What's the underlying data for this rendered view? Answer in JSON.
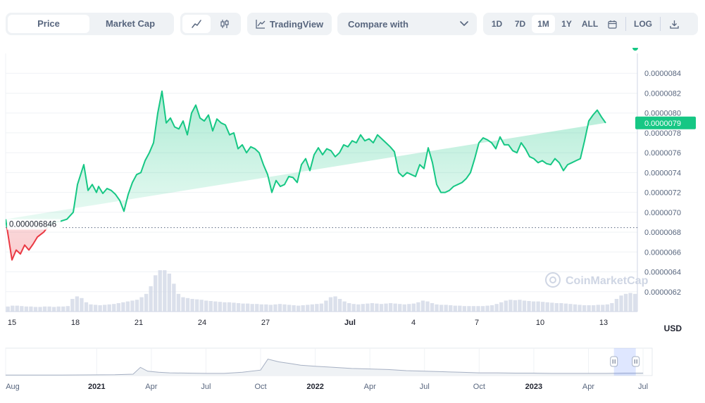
{
  "toolbar": {
    "type_tabs": [
      "Price",
      "Market Cap"
    ],
    "tradingview_label": "TradingView",
    "compare_label": "Compare with",
    "ranges": [
      "1D",
      "7D",
      "1M",
      "1Y",
      "ALL"
    ],
    "active_range": "1M",
    "log_label": "LOG"
  },
  "colors": {
    "up": "#16c784",
    "down": "#ea3943",
    "grid": "#eff2f5",
    "volume": "#cfd6e4"
  },
  "chart_data": {
    "type": "area",
    "currency": "USD",
    "watermark": "CoinMarketCap",
    "baseline_label": "0.000006846",
    "current_label": "0.0000079",
    "baseline": 6.846e-06,
    "ylim": [
      6e-06,
      8.6e-06
    ],
    "yticks": [
      "0.0000084",
      "0.0000082",
      "0.0000080",
      "0.0000078",
      "0.0000076",
      "0.0000074",
      "0.0000072",
      "0.0000070",
      "0.0000068",
      "0.0000066",
      "0.0000064",
      "0.0000062"
    ],
    "ytick_values": [
      8.4e-06,
      8.2e-06,
      8e-06,
      7.8e-06,
      7.6e-06,
      7.4e-06,
      7.2e-06,
      7e-06,
      6.8e-06,
      6.6e-06,
      6.4e-06,
      6.2e-06
    ],
    "xticks": [
      "15",
      "18",
      "21",
      "24",
      "27",
      "Jul",
      "4",
      "7",
      "10",
      "13"
    ],
    "xtick_days": [
      0,
      3,
      6,
      9,
      12,
      16,
      19,
      22,
      25,
      28
    ],
    "xlim_days": [
      -0.3,
      29.6
    ],
    "price_days": [
      -0.3,
      0,
      0.2,
      0.4,
      0.6,
      0.8,
      1,
      1.2,
      1.5,
      1.8,
      2,
      2.3,
      2.6,
      2.9,
      3.1,
      3.4,
      3.6,
      3.8,
      4,
      4.1,
      4.3,
      4.5,
      4.7,
      4.9,
      5.1,
      5.3,
      5.5,
      5.7,
      5.9,
      6.1,
      6.3,
      6.5,
      6.7,
      6.9,
      7.1,
      7.3,
      7.5,
      7.7,
      7.9,
      8.1,
      8.3,
      8.5,
      8.7,
      8.9,
      9.1,
      9.3,
      9.5,
      9.7,
      9.9,
      10.1,
      10.3,
      10.5,
      10.7,
      10.9,
      11.1,
      11.3,
      11.5,
      11.7,
      11.9,
      12.1,
      12.3,
      12.5,
      12.7,
      12.9,
      13.1,
      13.3,
      13.5,
      13.7,
      13.9,
      14.1,
      14.3,
      14.5,
      14.7,
      14.9,
      15.1,
      15.3,
      15.5,
      15.7,
      15.9,
      16.1,
      16.3,
      16.5,
      16.7,
      16.9,
      17.1,
      17.3,
      17.5,
      17.7,
      17.9,
      18.1,
      18.3,
      18.5,
      18.7,
      18.9,
      19.1,
      19.3,
      19.5,
      19.7,
      19.9,
      20.1,
      20.3,
      20.5,
      20.7,
      20.9,
      21.1,
      21.3,
      21.5,
      21.7,
      21.9,
      22.1,
      22.3,
      22.5,
      22.7,
      22.9,
      23.1,
      23.3,
      23.5,
      23.7,
      23.9,
      24.1,
      24.3,
      24.5,
      24.7,
      24.9,
      25.1,
      25.3,
      25.5,
      25.7,
      25.9,
      26.1,
      26.3,
      26.5,
      26.7,
      26.9,
      27.1,
      27.3,
      27.5,
      27.7,
      27.9,
      28.1,
      28.3,
      28.5,
      28.7,
      28.9,
      29.1,
      29.3,
      29.5
    ],
    "price_values": [
      6.93e-06,
      6.52e-06,
      6.62e-06,
      6.58e-06,
      6.67e-06,
      6.62e-06,
      6.68e-06,
      6.75e-06,
      6.8e-06,
      6.88e-06,
      6.9e-06,
      6.91e-06,
      6.93e-06,
      7e-06,
      7.28e-06,
      7.48e-06,
      7.22e-06,
      7.28e-06,
      7.2e-06,
      7.26e-06,
      7.19e-06,
      7.24e-06,
      7.22e-06,
      7.18e-06,
      7.12e-06,
      7.01e-06,
      7.18e-06,
      7.3e-06,
      7.38e-06,
      7.4e-06,
      7.52e-06,
      7.6e-06,
      7.7e-06,
      8e-06,
      8.22e-06,
      7.9e-06,
      7.95e-06,
      7.86e-06,
      7.84e-06,
      7.92e-06,
      7.78e-06,
      8e-06,
      8.08e-06,
      7.95e-06,
      7.92e-06,
      7.98e-06,
      7.82e-06,
      7.94e-06,
      7.9e-06,
      7.88e-06,
      7.78e-06,
      7.8e-06,
      7.64e-06,
      7.68e-06,
      7.6e-06,
      7.66e-06,
      7.64e-06,
      7.6e-06,
      7.48e-06,
      7.38e-06,
      7.2e-06,
      7.32e-06,
      7.26e-06,
      7.28e-06,
      7.36e-06,
      7.35e-06,
      7.3e-06,
      7.48e-06,
      7.54e-06,
      7.42e-06,
      7.58e-06,
      7.65e-06,
      7.58e-06,
      7.64e-06,
      7.62e-06,
      7.56e-06,
      7.6e-06,
      7.68e-06,
      7.66e-06,
      7.72e-06,
      7.7e-06,
      7.78e-06,
      7.72e-06,
      7.74e-06,
      7.7e-06,
      7.78e-06,
      7.74e-06,
      7.7e-06,
      7.66e-06,
      7.61e-06,
      7.4e-06,
      7.36e-06,
      7.4e-06,
      7.38e-06,
      7.36e-06,
      7.48e-06,
      7.44e-06,
      7.65e-06,
      7.5e-06,
      7.28e-06,
      7.2e-06,
      7.2e-06,
      7.22e-06,
      7.26e-06,
      7.28e-06,
      7.3e-06,
      7.34e-06,
      7.4e-06,
      7.54e-06,
      7.7e-06,
      7.75e-06,
      7.73e-06,
      7.7e-06,
      7.64e-06,
      7.76e-06,
      7.68e-06,
      7.68e-06,
      7.62e-06,
      7.6e-06,
      7.7e-06,
      7.64e-06,
      7.56e-06,
      7.54e-06,
      7.5e-06,
      7.52e-06,
      7.49e-06,
      7.48e-06,
      7.54e-06,
      7.5e-06,
      7.42e-06,
      7.48e-06,
      7.5e-06,
      7.52e-06,
      7.54e-06,
      7.72e-06,
      7.92e-06,
      7.98e-06,
      8.03e-06,
      7.96e-06,
      7.9e-06
    ],
    "volume_values": [
      0.12,
      0.14,
      0.14,
      0.13,
      0.12,
      0.12,
      0.11,
      0.11,
      0.12,
      0.12,
      0.11,
      0.12,
      0.12,
      0.13,
      0.3,
      0.36,
      0.32,
      0.22,
      0.17,
      0.16,
      0.15,
      0.16,
      0.17,
      0.18,
      0.2,
      0.22,
      0.24,
      0.26,
      0.28,
      0.34,
      0.42,
      0.6,
      0.86,
      0.98,
      0.98,
      0.9,
      0.66,
      0.42,
      0.34,
      0.32,
      0.3,
      0.29,
      0.28,
      0.26,
      0.25,
      0.24,
      0.23,
      0.22,
      0.22,
      0.21,
      0.2,
      0.19,
      0.19,
      0.18,
      0.18,
      0.17,
      0.17,
      0.16,
      0.17,
      0.18,
      0.17,
      0.16,
      0.15,
      0.14,
      0.15,
      0.16,
      0.17,
      0.18,
      0.19,
      0.26,
      0.34,
      0.36,
      0.3,
      0.24,
      0.2,
      0.18,
      0.17,
      0.18,
      0.19,
      0.2,
      0.19,
      0.18,
      0.19,
      0.2,
      0.19,
      0.18,
      0.17,
      0.18,
      0.19,
      0.22,
      0.26,
      0.24,
      0.2,
      0.17,
      0.16,
      0.16,
      0.15,
      0.14,
      0.14,
      0.13,
      0.13,
      0.13,
      0.13,
      0.13,
      0.14,
      0.15,
      0.18,
      0.22,
      0.26,
      0.28,
      0.27,
      0.28,
      0.26,
      0.25,
      0.24,
      0.24,
      0.23,
      0.22,
      0.21,
      0.2,
      0.2,
      0.19,
      0.18,
      0.17,
      0.16,
      0.15,
      0.15,
      0.15,
      0.16,
      0.16,
      0.17,
      0.2,
      0.3,
      0.38,
      0.42,
      0.44,
      0.42
    ],
    "navigator": {
      "labels": [
        "Aug",
        "2021",
        "Apr",
        "Jul",
        "Oct",
        "2022",
        "Apr",
        "Jul",
        "Oct",
        "2023",
        "Apr",
        "Jul"
      ],
      "bold_labels": [
        false,
        true,
        false,
        false,
        false,
        true,
        false,
        false,
        false,
        true,
        false,
        false
      ],
      "label_months": [
        0,
        5,
        8,
        11,
        14,
        17,
        20,
        23,
        26,
        29,
        32,
        35
      ],
      "xlim_months": [
        0,
        35.5
      ],
      "selected_months": [
        33.4,
        34.6
      ],
      "history_months": [
        0,
        3,
        6,
        7,
        7.4,
        7.8,
        8.4,
        9,
        10,
        11,
        12,
        13,
        14,
        14.4,
        15,
        15.6,
        16.2,
        17,
        18,
        19,
        20,
        21,
        22,
        23,
        24,
        25,
        26,
        27,
        28,
        29,
        30,
        31,
        32,
        33,
        34,
        35
      ],
      "history_values": [
        0.02,
        0.02,
        0.03,
        0.05,
        0.3,
        0.16,
        0.12,
        0.1,
        0.09,
        0.08,
        0.08,
        0.12,
        0.2,
        0.6,
        0.5,
        0.44,
        0.38,
        0.34,
        0.3,
        0.26,
        0.24,
        0.22,
        0.18,
        0.16,
        0.14,
        0.12,
        0.1,
        0.1,
        0.09,
        0.09,
        0.08,
        0.08,
        0.08,
        0.08,
        0.09,
        0.09
      ]
    }
  }
}
